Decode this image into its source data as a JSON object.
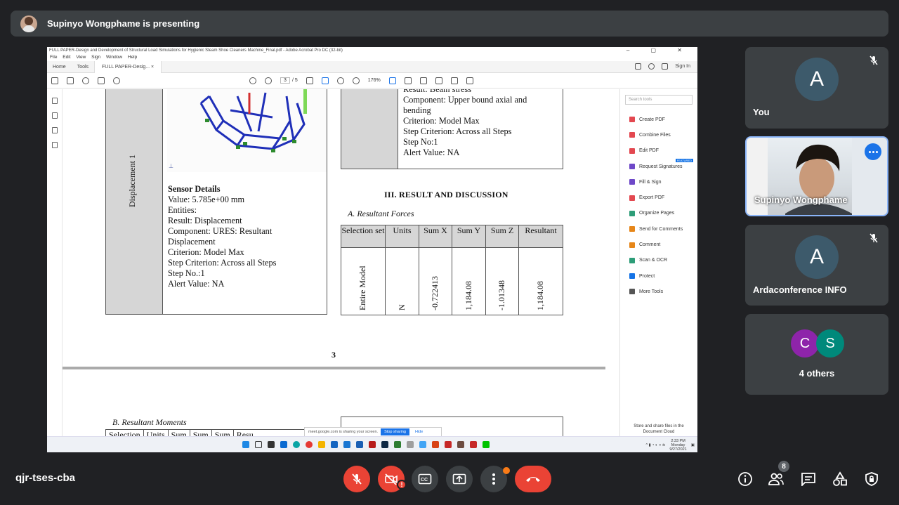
{
  "banner": {
    "presenter_text": "Supinyo Wongphame is presenting"
  },
  "shared_screen": {
    "window_title": "FULL PAPER-Design and Development of Structural Load Simulations for Hygienic Steam Shoe Cleaners Machine_Final.pdf - Adobe Acrobat Pro DC (32-bit)",
    "window_controls": "–  ▢  ✕",
    "menu": [
      "File",
      "Edit",
      "View",
      "Sign",
      "Window",
      "Help"
    ],
    "tabs": {
      "home": "Home",
      "tools": "Tools",
      "doc": "FULL PAPER-Desig...",
      "sign_in": "Sign In"
    },
    "toolbar": {
      "page_current": "3",
      "page_total": "/ 5",
      "zoom": "176%"
    },
    "document": {
      "vertical_label": "Displacement 1",
      "sensor_details": {
        "heading": "Sensor Details",
        "value": "Value: 5.785e+00 mm",
        "entities": "Entities:",
        "result": "Result: Displacement",
        "component_1": "Component: URES: Resultant",
        "component_2": "Displacement",
        "criterion": "Criterion: Model Max",
        "step_criterion": "Step Criterion: Across all Steps",
        "step_no": "Step No.:1",
        "alert": "Alert Value: NA"
      },
      "beam_details": {
        "result": "Result: Beam stress",
        "component_1": "Component: Upper bound axial and",
        "component_2": "bending",
        "criterion": "Criterion: Model Max",
        "step_criterion": "Step Criterion: Across all Steps",
        "step_no": "Step No:1",
        "alert": "Alert Value: NA"
      },
      "section_heading": "III.   RESULT AND DISCUSSION",
      "subsection_a": "A.   Resultant Forces",
      "forces_table": {
        "headers": [
          "Selection set",
          "Units",
          "Sum X",
          "Sum Y",
          "Sum Z",
          "Resultant"
        ],
        "row": [
          "Entire Model",
          "N",
          "-0.722413",
          "1,184.08",
          "-1.01348",
          "1,184.08"
        ]
      },
      "page_number": "3",
      "subsection_b": "B.   Resultant Moments",
      "moments_headers": [
        "Selection",
        "Units",
        "Sum",
        "Sum",
        "Sum",
        "Resu"
      ]
    },
    "tools_pane": {
      "search_placeholder": "Search tools",
      "items": [
        {
          "label": "Create PDF",
          "color": "#e34850"
        },
        {
          "label": "Combine Files",
          "color": "#e34850"
        },
        {
          "label": "Edit PDF",
          "color": "#e34850"
        },
        {
          "label": "Request Signatures",
          "color": "#6e48c8"
        },
        {
          "label": "Fill & Sign",
          "color": "#6e48c8"
        },
        {
          "label": "Export PDF",
          "color": "#e34850"
        },
        {
          "label": "Organize Pages",
          "color": "#2d9d78"
        },
        {
          "label": "Send for Comments",
          "color": "#e68619"
        },
        {
          "label": "Comment",
          "color": "#e68619"
        },
        {
          "label": "Scan & OCR",
          "color": "#2d9d78"
        },
        {
          "label": "Protect",
          "color": "#1473e6"
        },
        {
          "label": "More Tools",
          "color": "#555555"
        }
      ],
      "featured_badge": "FEATURED",
      "footer_1": "Store and share files in the",
      "footer_2": "Document Cloud"
    },
    "share_bar": {
      "message": "meet.google.com is sharing your screen.",
      "stop": "Stop sharing",
      "hide": "Hide"
    },
    "taskbar": {
      "time": "2:33 PM",
      "day": "Monday",
      "date": "9/27/2021"
    }
  },
  "participants": [
    {
      "name": "You",
      "initial": "A",
      "muted": true
    },
    {
      "name": "Supinyo Wongphame",
      "video": true
    },
    {
      "name": "Ardaconference INFO",
      "initial": "A",
      "muted": true
    },
    {
      "name": "4 others",
      "initials": [
        "C",
        "S"
      ]
    }
  ],
  "colors": {
    "avatar_c": "#8e24aa",
    "avatar_s": "#00897b",
    "danger": "#ea4335",
    "accent": "#1a73e8"
  },
  "bottom_bar": {
    "meeting_code": "qjr-tses-cba",
    "people_count": "8"
  }
}
